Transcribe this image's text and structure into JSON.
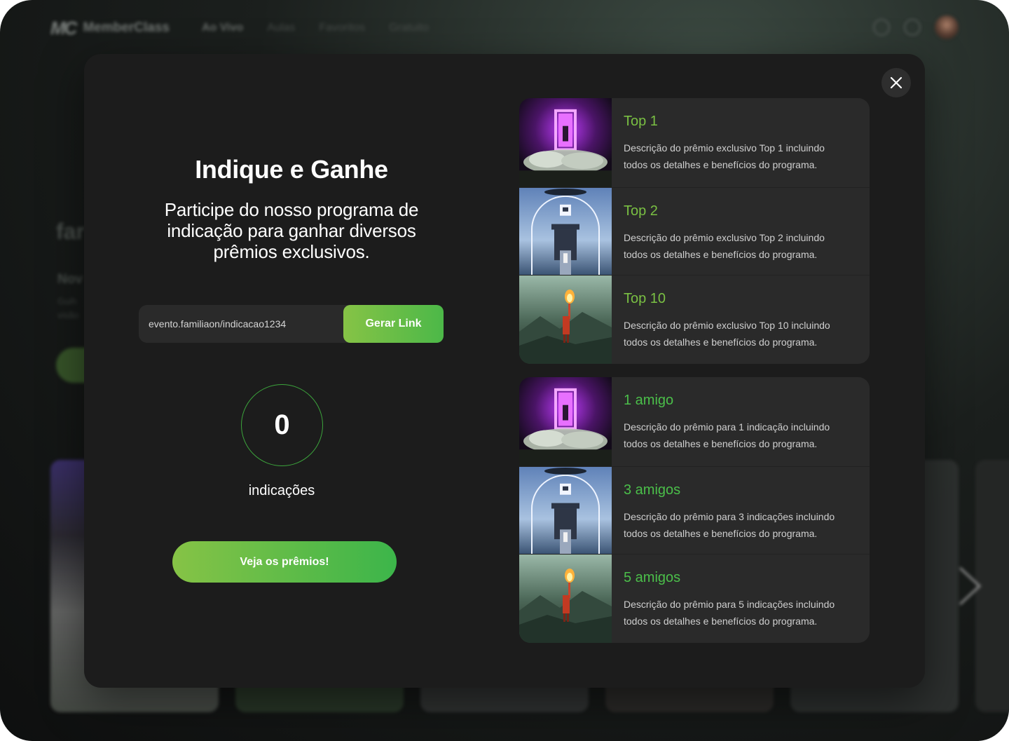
{
  "background": {
    "logo_mark": "MC",
    "logo_text": "MemberClass",
    "nav": [
      {
        "label": "Ao Vivo"
      },
      {
        "label": "Aulas"
      },
      {
        "label": "Favoritos"
      },
      {
        "label": "Gratuito"
      }
    ],
    "hero_word": "far",
    "hero_sub": "Nov",
    "hero_sub2_line1": "Guih",
    "hero_sub2_line2": "visão"
  },
  "modal": {
    "title": "Indique e Ganhe",
    "subtitle": "Participe do nosso programa de indicação para ganhar diversos prêmios exclusivos.",
    "link_value": "evento.familiaon/indicacao1234",
    "generate_label": "Gerar Link",
    "count": "0",
    "count_label": "indicações",
    "prizes_button": "Veja os prêmios!"
  },
  "ranking_prizes": [
    {
      "title": "Top 1",
      "desc": "Descrição do prêmio exclusivo Top 1 incluindo todos os detalhes e benefícios do programa.",
      "image": "purple-portal"
    },
    {
      "title": "Top 2",
      "desc": "Descrição do prêmio exclusivo Top 2 incluindo todos os detalhes e benefícios do programa.",
      "image": "sky-gate"
    },
    {
      "title": "Top 10",
      "desc": "Descrição do prêmio exclusivo Top 10 incluindo todos os detalhes e benefícios do programa.",
      "image": "mountain-torch"
    }
  ],
  "referral_prizes": [
    {
      "title": "1 amigo",
      "desc": "Descrição do prêmio para 1 indicação incluindo todos os detalhes e benefícios do programa.",
      "image": "purple-portal"
    },
    {
      "title": "3 amigos",
      "desc": "Descrição do prêmio para 3 indicações incluindo todos os detalhes e benefícios do programa.",
      "image": "sky-gate"
    },
    {
      "title": "5 amigos",
      "desc": "Descrição do prêmio para 5 indicações incluindo todos os detalhes e benefícios do programa.",
      "image": "mountain-torch"
    }
  ],
  "colors": {
    "accent_green": "#7ac043",
    "accent_green_2": "#4bbf4a",
    "modal_bg": "#1c1c1c",
    "panel_bg": "#2a2a2a"
  }
}
